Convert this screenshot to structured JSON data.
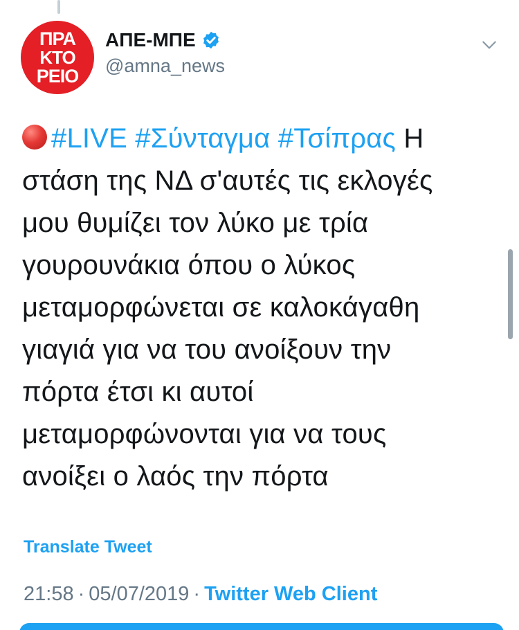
{
  "tweet": {
    "avatar_lines": [
      "ΠΡΑ",
      "ΚΤΟ",
      "ΡΕΙΟ"
    ],
    "display_name": "ΑΠΕ-ΜΠΕ",
    "handle": "@amna_news",
    "text_lines": [
      {
        "hashtags": [
          "#LIVE",
          "#Σύνταγμα",
          "#Τσίπρας"
        ],
        "rest": " Η"
      },
      "στάση της ΝΔ σ'αυτές τις εκλογές",
      "μου θυμίζει τον λύκο με τρία",
      "γουρουνάκια όπου ο λύκος",
      "μεταμορφώνεται σε καλοκάγαθη",
      "γιαγιά για να του ανοίξουν την",
      "πόρτα έτσι κι αυτοί",
      "μεταμορφώνονται για να τους",
      "ανοίξει ο λαός την πόρτα"
    ],
    "translate_label": "Translate Tweet",
    "time": "21:58",
    "date": "05/07/2019",
    "source": "Twitter Web Client",
    "separator": "·"
  },
  "colors": {
    "accent": "#1da1f2",
    "avatar_bg": "#e41f26",
    "secondary_text": "#657786"
  },
  "icons": {
    "verified": "verified-badge-icon",
    "menu": "chevron-down-icon",
    "live": "red-circle-icon"
  }
}
